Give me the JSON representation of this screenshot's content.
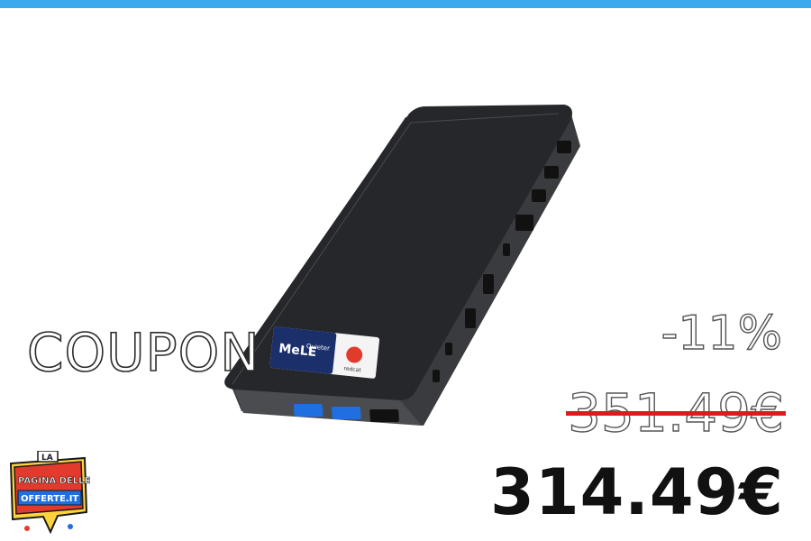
{
  "promo": {
    "coupon_label": "COUPON",
    "discount": "-11%",
    "old_price": "351.49€",
    "new_price": "314.49€"
  },
  "logo": {
    "top": "LA",
    "line1": "PAGINA DELLE",
    "line2": "OFFERTE.IT"
  },
  "product": {
    "sticker_brand": "MeLE",
    "sticker_sub": "Quieter",
    "sticker_badge": "redcat"
  },
  "colors": {
    "top_bar": "#3aa9ee",
    "strike": "#e0191e",
    "port_blue": "#1f6fe0",
    "logo_red": "#e23b2e",
    "logo_yellow": "#ffd33d"
  }
}
